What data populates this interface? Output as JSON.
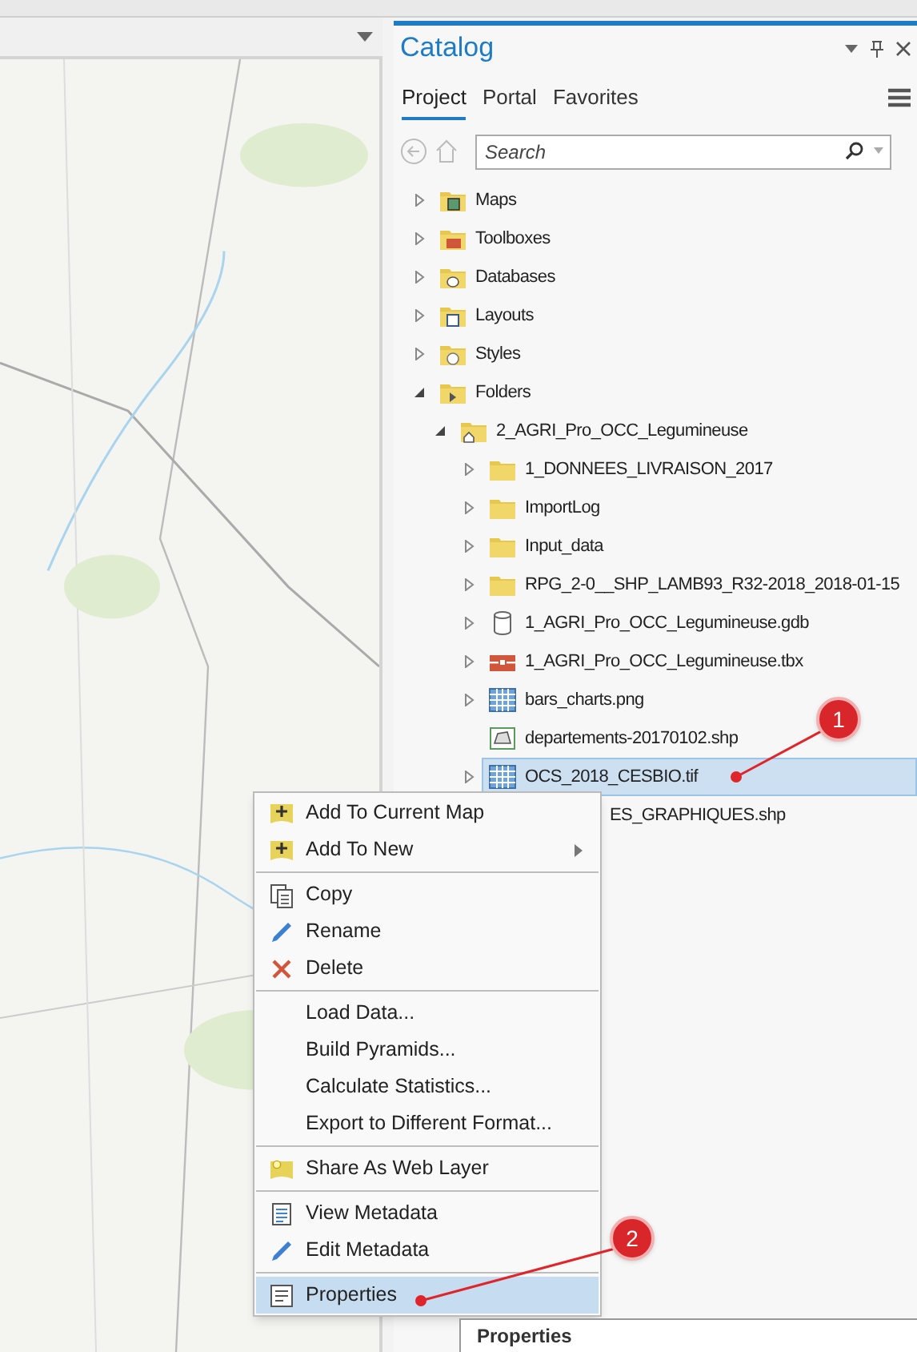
{
  "catalog": {
    "title": "Catalog",
    "tabs": [
      {
        "label": "Project",
        "selected": true
      },
      {
        "label": "Portal",
        "selected": false
      },
      {
        "label": "Favorites",
        "selected": false
      }
    ],
    "search": {
      "placeholder": "Search"
    },
    "tree": [
      {
        "name": "Maps",
        "kind": "maps",
        "expanded": false
      },
      {
        "name": "Toolboxes",
        "kind": "toolboxes",
        "expanded": false
      },
      {
        "name": "Databases",
        "kind": "databases",
        "expanded": false
      },
      {
        "name": "Layouts",
        "kind": "layouts",
        "expanded": false
      },
      {
        "name": "Styles",
        "kind": "styles",
        "expanded": false
      },
      {
        "name": "Folders",
        "kind": "folders",
        "expanded": true,
        "children": [
          {
            "name": "2_AGRI_Pro_OCC_Legumineuse",
            "kind": "home-folder",
            "expanded": true,
            "children": [
              {
                "name": "1_DONNEES_LIVRAISON_2017",
                "kind": "folder",
                "expanded": false
              },
              {
                "name": "ImportLog",
                "kind": "folder",
                "expanded": false
              },
              {
                "name": "Input_data",
                "kind": "folder",
                "expanded": false
              },
              {
                "name": "RPG_2-0__SHP_LAMB93_R32-2018_2018-01-15",
                "kind": "folder",
                "expanded": false
              },
              {
                "name": "1_AGRI_Pro_OCC_Legumineuse.gdb",
                "kind": "gdb",
                "expanded": false
              },
              {
                "name": "1_AGRI_Pro_OCC_Legumineuse.tbx",
                "kind": "tbx",
                "expanded": false
              },
              {
                "name": "bars_charts.png",
                "kind": "raster",
                "expanded": false
              },
              {
                "name": "departements-20170102.shp",
                "kind": "shapefile",
                "selected": false
              },
              {
                "name": "OCS_2018_CESBIO.tif",
                "kind": "raster",
                "expanded": false,
                "selected": true
              },
              {
                "name": "ES_GRAPHIQUES.shp",
                "kind": "covered",
                "selected": false
              }
            ]
          }
        ]
      }
    ]
  },
  "context_menu": [
    [
      {
        "label": "Add To Current Map",
        "kind": "add",
        "submenu": false,
        "selected": false
      },
      {
        "label": "Add To New",
        "kind": "add",
        "submenu": true,
        "selected": false
      }
    ],
    [
      {
        "label": "Copy",
        "kind": "copy",
        "selected": false
      },
      {
        "label": "Rename",
        "kind": "pencil",
        "selected": false
      },
      {
        "label": "Delete",
        "kind": "delete",
        "selected": false
      }
    ],
    [
      {
        "label": "Load Data...",
        "selected": false
      },
      {
        "label": "Build Pyramids...",
        "selected": false
      },
      {
        "label": "Calculate Statistics...",
        "selected": false
      },
      {
        "label": "Export to Different Format...",
        "selected": false
      }
    ],
    [
      {
        "label": "Share As Web Layer",
        "kind": "share",
        "selected": false
      }
    ],
    [
      {
        "label": "View Metadata",
        "kind": "document",
        "selected": false
      },
      {
        "label": "Edit Metadata",
        "kind": "pencil",
        "selected": false
      }
    ],
    [
      {
        "label": "Properties",
        "kind": "properties",
        "selected": true
      }
    ]
  ],
  "tooltip": {
    "title": "Properties"
  },
  "callouts": [
    {
      "label": "1"
    },
    {
      "label": "2"
    }
  ]
}
